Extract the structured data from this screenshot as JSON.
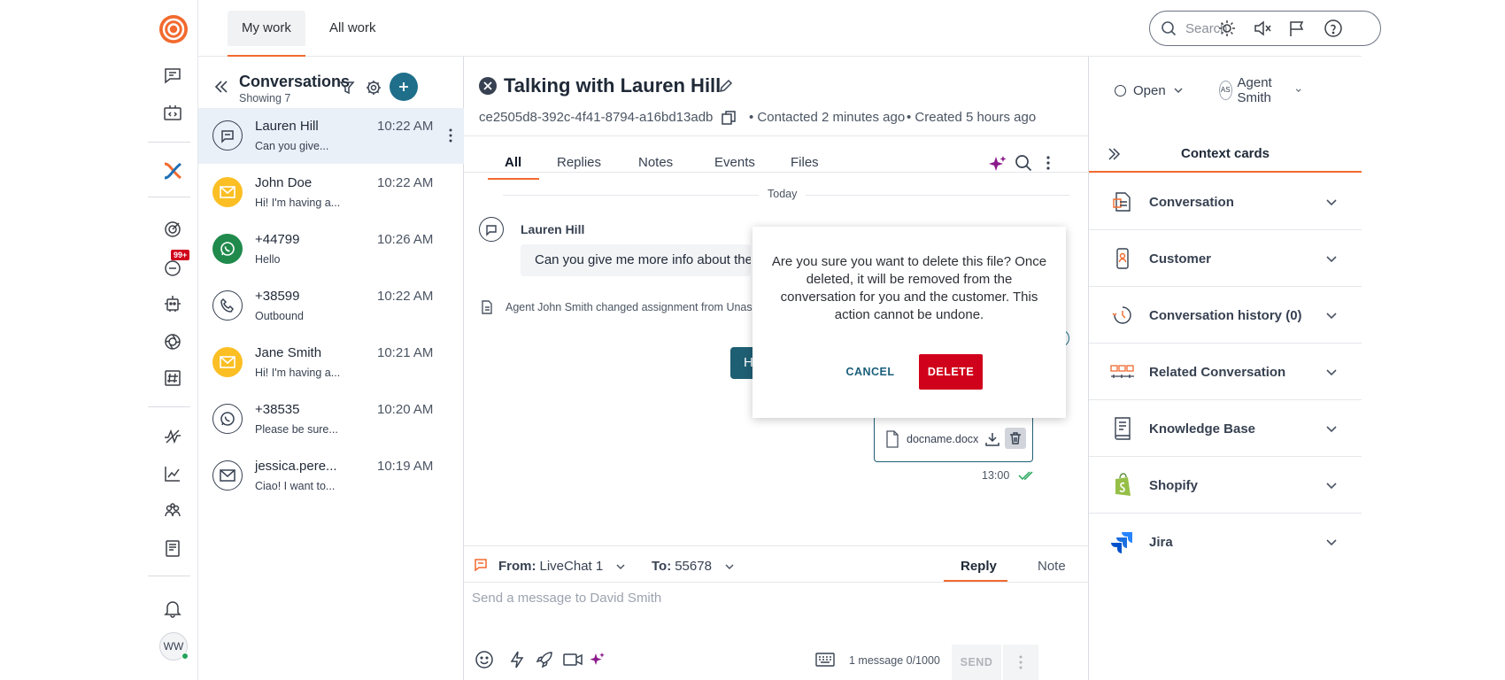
{
  "top_tabs": [
    {
      "label": "My work",
      "active": true
    },
    {
      "label": "All work",
      "active": false
    }
  ],
  "search": {
    "placeholder": "Search"
  },
  "nav": {
    "badge": "99+",
    "user_initials": "WW",
    "icons": [
      "logo-icon",
      "conversations-icon",
      "code-icon",
      "brand-x-icon",
      "target-icon",
      "chat-badge-icon",
      "bot-icon",
      "aperture-icon",
      "hashtag-icon",
      "pulse-icon",
      "chart-icon",
      "people-icon",
      "book-icon",
      "bell-icon"
    ]
  },
  "conversations": {
    "title": "Conversations",
    "count": "Showing 7",
    "items": [
      {
        "name": "Lauren Hill",
        "preview": "Can you give...",
        "time": "10:22 AM",
        "channel": "livechat",
        "active": true
      },
      {
        "name": "John Doe",
        "preview": "Hi! I'm having a...",
        "time": "10:22 AM",
        "channel": "email"
      },
      {
        "name": "+44799",
        "preview": "Hello",
        "time": "10:26 AM",
        "channel": "whatsapp"
      },
      {
        "name": "+38599",
        "preview": "Outbound",
        "time": "10:22 AM",
        "channel": "phone"
      },
      {
        "name": "Jane Smith",
        "preview": "Hi! I'm having a...",
        "time": "10:21 AM",
        "channel": "email"
      },
      {
        "name": "+38535",
        "preview": "Please be sure...",
        "time": "10:20 AM",
        "channel": "whatsapp-outline"
      },
      {
        "name": "jessica.pere...",
        "preview": "Ciao! I want to...",
        "time": "10:19 AM",
        "channel": "email-outline"
      }
    ]
  },
  "main": {
    "title": "Talking with Lauren Hill",
    "conversation_id": "ce2505d8-392c-4f41-8794-a16bd13adb",
    "contacted": "Contacted 2 minutes ago",
    "created": "Created 5 hours ago",
    "status": "Open",
    "agent_initials": "AS",
    "agent": "Agent Smith",
    "tabs": [
      "All",
      "Replies",
      "Notes",
      "Events",
      "Files"
    ],
    "today_label": "Today",
    "sender": "Lauren Hill",
    "message": "Can you give me more info about the p",
    "event": "Agent John Smith changed assignment from Unas",
    "outgoing_partial": "Hi",
    "file_name": "docname.docx",
    "file_time": "13:00"
  },
  "composer": {
    "from_label": "From:",
    "from_value": "LiveChat 1",
    "to_label": "To:",
    "to_value": "55678",
    "reply_tab": "Reply",
    "note_tab": "Note",
    "placeholder": "Send a message to David Smith",
    "counter": "1 message 0/1000",
    "send": "SEND"
  },
  "context": {
    "title": "Context cards",
    "cards": [
      {
        "label": "Conversation",
        "icon": "document-icon"
      },
      {
        "label": "Customer",
        "icon": "phone-user-icon"
      },
      {
        "label": "Conversation history (0)",
        "icon": "history-icon"
      },
      {
        "label": "Related Conversation",
        "icon": "related-icon"
      },
      {
        "label": "Knowledge Base",
        "icon": "knowledge-icon"
      },
      {
        "label": "Shopify",
        "icon": "shopify-icon"
      },
      {
        "label": "Jira",
        "icon": "jira-icon"
      }
    ]
  },
  "modal": {
    "message": "Are you sure you want to delete this file? Once deleted, it will be removed from the conversation for you and the customer. This action cannot be undone.",
    "cancel": "CANCEL",
    "delete": "DELETE"
  },
  "colors": {
    "accent": "#f26a2e",
    "brand_blue": "#1f6f8b",
    "danger": "#d0021b",
    "active_row": "#eaf0f8"
  }
}
